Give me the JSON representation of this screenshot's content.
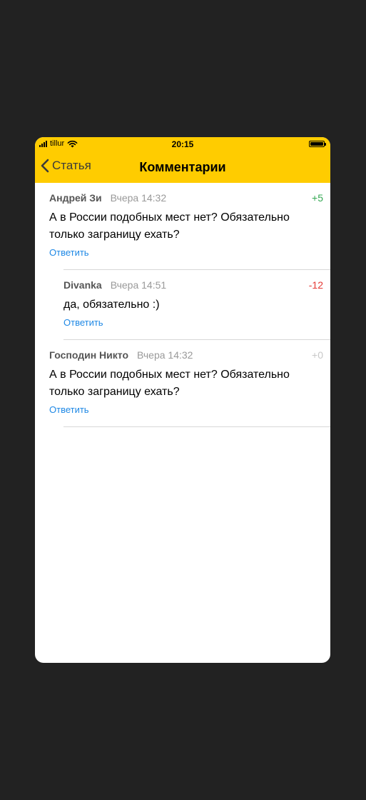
{
  "status_bar": {
    "carrier": "tillur",
    "time": "20:15"
  },
  "nav": {
    "back_label": "Статья",
    "title": "Комментарии"
  },
  "comments": [
    {
      "author": "Андрей Зи",
      "date": "Вчера 14:32",
      "score": "+5",
      "score_color": "#34A853",
      "text": "А в России подобных мест нет? Обязательно только заграницу ехать?",
      "reply_label": "Ответить"
    },
    {
      "author": "Divanka",
      "date": "Вчера 14:51",
      "score": "-12",
      "score_color": "#E53935",
      "text": "да, обязательно :)",
      "reply_label": "Ответить"
    },
    {
      "author": "Господин Никто",
      "date": "Вчера 14:32",
      "score": "+0",
      "score_color": "#C8C8C8",
      "text": "А в России подобных мест нет? Обязательно только заграницу ехать?",
      "reply_label": "Ответить"
    }
  ],
  "colors": {
    "header_bg": "#FFCC00",
    "link": "#1E88E5",
    "page_bg": "#222222"
  }
}
